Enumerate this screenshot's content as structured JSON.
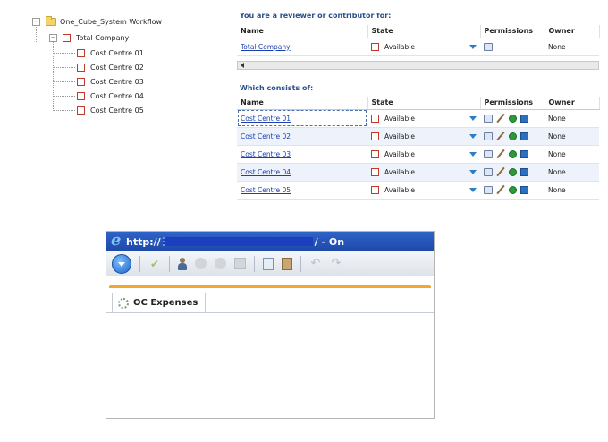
{
  "tree": {
    "root_label": "One_Cube_System Workflow",
    "company_label": "Total Company",
    "children": [
      "Cost Centre 01",
      "Cost Centre 02",
      "Cost Centre 03",
      "Cost Centre 04",
      "Cost Centre 05"
    ],
    "expander_symbol": "−"
  },
  "reviewer_section": {
    "title": "You are a reviewer or contributor for:",
    "columns": [
      "Name",
      "State",
      "Permissions",
      "Owner"
    ],
    "rows": [
      {
        "name": "Total Company",
        "state": "Available",
        "owner": "None"
      }
    ]
  },
  "consists_section": {
    "title": "Which consists of:",
    "columns": [
      "Name",
      "State",
      "Permissions",
      "Owner"
    ],
    "rows": [
      {
        "name": "Cost Centre 01",
        "state": "Available",
        "owner": "None"
      },
      {
        "name": "Cost Centre 02",
        "state": "Available",
        "owner": "None"
      },
      {
        "name": "Cost Centre 03",
        "state": "Available",
        "owner": "None"
      },
      {
        "name": "Cost Centre 04",
        "state": "Available",
        "owner": "None"
      },
      {
        "name": "Cost Centre 05",
        "state": "Available",
        "owner": "None"
      }
    ]
  },
  "browser": {
    "url_prefix": "http://",
    "url_suffix": "/ - On",
    "tab_label": "OC Expenses"
  },
  "colors": {
    "link": "#1a3fb0",
    "section_title": "#2a4f8c",
    "state_square": "#c0392b",
    "titlebar": "#2f63c8",
    "tab_accent": "#f0a92e"
  },
  "icons": {
    "state": "red-square-icon",
    "dropdown": "dropdown-arrow-icon",
    "permissions": [
      "book-icon",
      "pencil-icon",
      "green-circle-icon",
      "blue-square-icon"
    ]
  }
}
